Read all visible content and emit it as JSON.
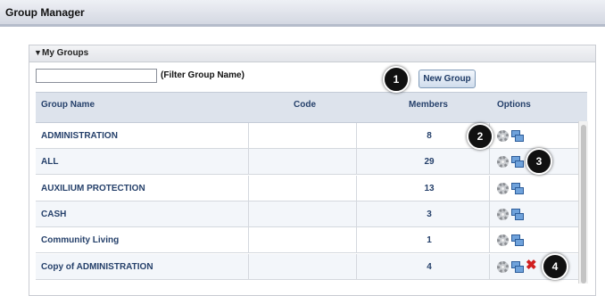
{
  "app": {
    "title": "Group Manager"
  },
  "panel": {
    "title": "My Groups"
  },
  "filter": {
    "value": "",
    "label": "(Filter Group Name)"
  },
  "toolbar": {
    "new_group_label": "New Group"
  },
  "table": {
    "headers": {
      "name": "Group Name",
      "code": "Code",
      "members": "Members",
      "options": "Options"
    },
    "rows": [
      {
        "name": "ADMINISTRATION",
        "code": "",
        "members": "8",
        "delete": false
      },
      {
        "name": "ALL",
        "code": "",
        "members": "29",
        "delete": false
      },
      {
        "name": "AUXILIUM PROTECTION",
        "code": "",
        "members": "13",
        "delete": false
      },
      {
        "name": "CASH",
        "code": "",
        "members": "3",
        "delete": false
      },
      {
        "name": "Community Living",
        "code": "",
        "members": "1",
        "delete": false
      },
      {
        "name": "Copy of ADMINISTRATION",
        "code": "",
        "members": "4",
        "delete": true
      }
    ]
  },
  "callouts": [
    "1",
    "2",
    "3",
    "4"
  ],
  "icons": {
    "edit": "gear-icon",
    "copy": "copy-icon",
    "delete": "delete-icon"
  },
  "colors": {
    "link": "#26416b",
    "delete": "#d11f1f"
  }
}
